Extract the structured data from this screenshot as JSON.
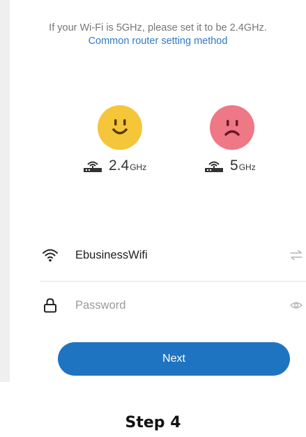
{
  "notice": {
    "text": "If your Wi-Fi is 5GHz, please set it to be 2.4GHz.",
    "link_label": "Common router setting method"
  },
  "bands": [
    {
      "number": "2.4",
      "unit": "GHz",
      "status": "supported",
      "face_icon": "happy-face-icon",
      "face_color": "#f5c53a"
    },
    {
      "number": "5",
      "unit": "GHz",
      "status": "unsupported",
      "face_icon": "sad-face-icon",
      "face_color": "#ee7886"
    }
  ],
  "wifi": {
    "ssid": "EbusinessWifi",
    "icon": "wifi-icon",
    "switch_icon": "swap-arrows-icon"
  },
  "password": {
    "value": "",
    "placeholder": "Password",
    "icon": "lock-icon",
    "toggle_icon": "eye-icon"
  },
  "next_button": {
    "label": "Next",
    "color": "#1f74c1"
  },
  "caption": "Step 4"
}
